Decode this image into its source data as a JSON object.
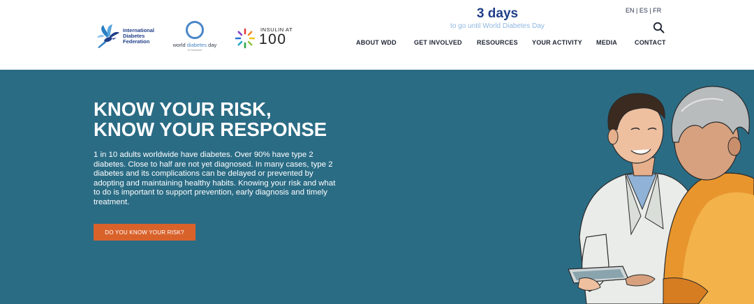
{
  "header": {
    "idf_logo": {
      "lines": [
        "International",
        "Diabetes",
        "Federation"
      ]
    },
    "wdd_logo": {
      "name_part1": "world ",
      "name_accent": "diabetes",
      "name_part2": " day",
      "date": "14 November"
    },
    "insulin_logo": {
      "small": "INSULIN AT",
      "big": "100"
    },
    "countdown": {
      "number": "3 days",
      "caption": "to go until World Diabetes Day"
    },
    "languages": [
      "EN",
      "ES",
      "FR"
    ],
    "language_separator": " | ",
    "search_icon": "search-icon"
  },
  "nav": {
    "items": [
      "ABOUT WDD",
      "GET INVOLVED",
      "RESOURCES",
      "YOUR ACTIVITY",
      "MEDIA",
      "CONTACT"
    ]
  },
  "hero": {
    "title_lines": [
      "KNOW YOUR RISK,",
      "KNOW YOUR RESPONSE"
    ],
    "body": "1 in 10 adults worldwide have diabetes. Over 90% have type 2 diabetes. Close to half are not yet diagnosed. In many cases, type 2 diabetes and its complications can be delayed or prevented by adopting and maintaining healthy habits. Knowing your risk and what to do is important to support prevention, early diagnosis and timely treatment.",
    "cta_label": "DO YOU KNOW YOUR RISK?"
  },
  "colors": {
    "brand_navy": "#1f3e88",
    "hero_background": "#2b6c85",
    "cta_orange": "#d9622b",
    "countdown_caption": "#8fb7e2"
  }
}
